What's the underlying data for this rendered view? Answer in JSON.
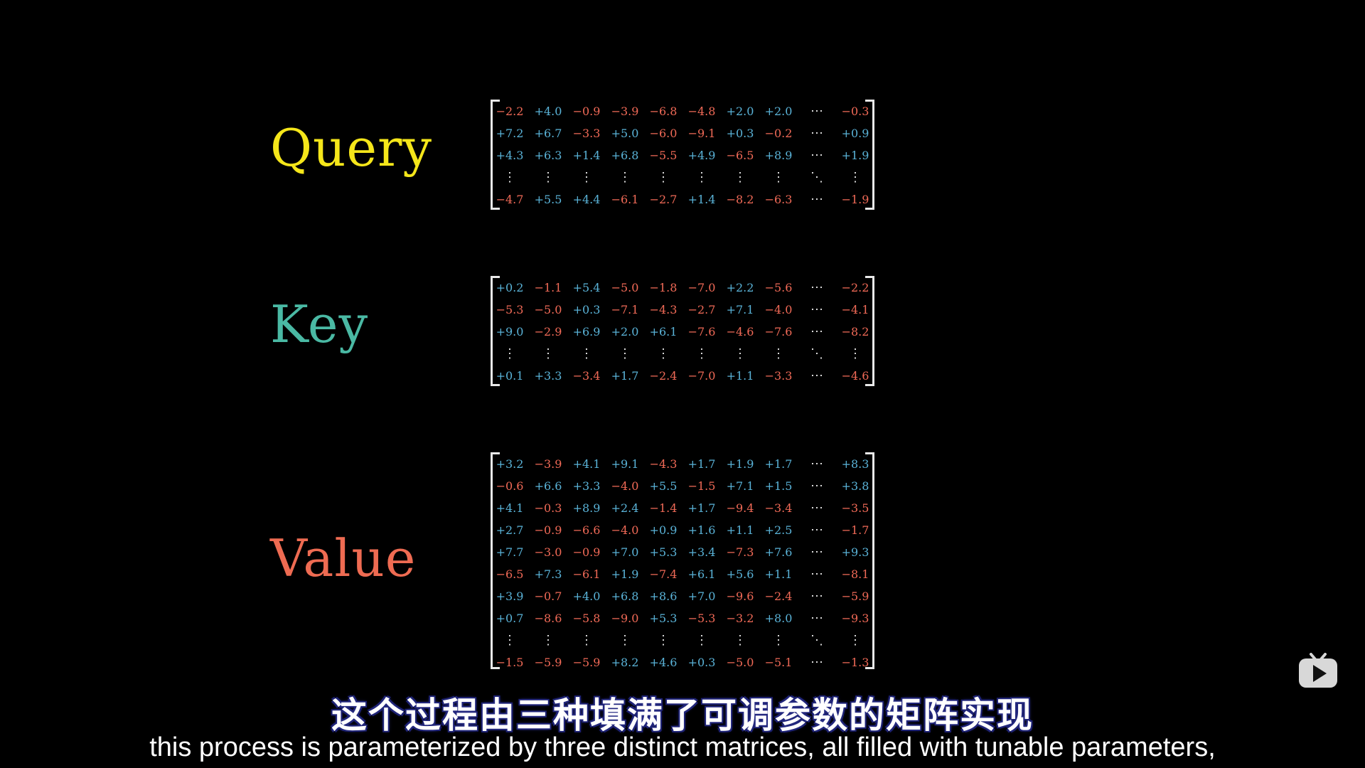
{
  "labels": {
    "query": "Query",
    "key": "Key",
    "value": "Value"
  },
  "matrices": {
    "query": {
      "rows": [
        [
          "−2.2",
          "+4.0",
          "−0.9",
          "−3.9",
          "−6.8",
          "−4.8",
          "+2.0",
          "+2.0",
          "⋯",
          "−0.3"
        ],
        [
          "+7.2",
          "+6.7",
          "−3.3",
          "+5.0",
          "−6.0",
          "−9.1",
          "+0.3",
          "−0.2",
          "⋯",
          "+0.9"
        ],
        [
          "+4.3",
          "+6.3",
          "+1.4",
          "+6.8",
          "−5.5",
          "+4.9",
          "−6.5",
          "+8.9",
          "⋯",
          "+1.9"
        ],
        [
          "⋮",
          "⋮",
          "⋮",
          "⋮",
          "⋮",
          "⋮",
          "⋮",
          "⋮",
          "⋱",
          "⋮"
        ],
        [
          "−4.7",
          "+5.5",
          "+4.4",
          "−6.1",
          "−2.7",
          "+1.4",
          "−8.2",
          "−6.3",
          "⋯",
          "−1.9"
        ]
      ]
    },
    "key": {
      "rows": [
        [
          "+0.2",
          "−1.1",
          "+5.4",
          "−5.0",
          "−1.8",
          "−7.0",
          "+2.2",
          "−5.6",
          "⋯",
          "−2.2"
        ],
        [
          "−5.3",
          "−5.0",
          "+0.3",
          "−7.1",
          "−4.3",
          "−2.7",
          "+7.1",
          "−4.0",
          "⋯",
          "−4.1"
        ],
        [
          "+9.0",
          "−2.9",
          "+6.9",
          "+2.0",
          "+6.1",
          "−7.6",
          "−4.6",
          "−7.6",
          "⋯",
          "−8.2"
        ],
        [
          "⋮",
          "⋮",
          "⋮",
          "⋮",
          "⋮",
          "⋮",
          "⋮",
          "⋮",
          "⋱",
          "⋮"
        ],
        [
          "+0.1",
          "+3.3",
          "−3.4",
          "+1.7",
          "−2.4",
          "−7.0",
          "+1.1",
          "−3.3",
          "⋯",
          "−4.6"
        ]
      ]
    },
    "value": {
      "rows": [
        [
          "+3.2",
          "−3.9",
          "+4.1",
          "+9.1",
          "−4.3",
          "+1.7",
          "+1.9",
          "+1.7",
          "⋯",
          "+8.3"
        ],
        [
          "−0.6",
          "+6.6",
          "+3.3",
          "−4.0",
          "+5.5",
          "−1.5",
          "+7.1",
          "+1.5",
          "⋯",
          "+3.8"
        ],
        [
          "+4.1",
          "−0.3",
          "+8.9",
          "+2.4",
          "−1.4",
          "+1.7",
          "−9.4",
          "−3.4",
          "⋯",
          "−3.5"
        ],
        [
          "+2.7",
          "−0.9",
          "−6.6",
          "−4.0",
          "+0.9",
          "+1.6",
          "+1.1",
          "+2.5",
          "⋯",
          "−1.7"
        ],
        [
          "+7.7",
          "−3.0",
          "−0.9",
          "+7.0",
          "+5.3",
          "+3.4",
          "−7.3",
          "+7.6",
          "⋯",
          "+9.3"
        ],
        [
          "−6.5",
          "+7.3",
          "−6.1",
          "+1.9",
          "−7.4",
          "+6.1",
          "+5.6",
          "+1.1",
          "⋯",
          "−8.1"
        ],
        [
          "+3.9",
          "−0.7",
          "+4.0",
          "+6.8",
          "+8.6",
          "+7.0",
          "−9.6",
          "−2.4",
          "⋯",
          "−5.9"
        ],
        [
          "+0.7",
          "−8.6",
          "−5.8",
          "−9.0",
          "+5.3",
          "−5.3",
          "−3.2",
          "+8.0",
          "⋯",
          "−9.3"
        ],
        [
          "⋮",
          "⋮",
          "⋮",
          "⋮",
          "⋮",
          "⋮",
          "⋮",
          "⋮",
          "⋱",
          "⋮"
        ],
        [
          "−1.5",
          "−5.9",
          "−5.9",
          "+8.2",
          "+4.6",
          "+0.3",
          "−5.0",
          "−5.1",
          "⋯",
          "−1.3"
        ]
      ]
    }
  },
  "subtitles": {
    "chinese": "这个过程由三种填满了可调参数的矩阵实现",
    "english": "this process is parameterized by three distinct matrices, all filled with tunable parameters,"
  },
  "colors": {
    "query": "#f5e61a",
    "key": "#4ab9a4",
    "value": "#ee6b52",
    "positive": "#5ab3d8",
    "negative": "#f16a57",
    "background": "#000000"
  },
  "icons": {
    "watermark": "video-play-icon"
  }
}
